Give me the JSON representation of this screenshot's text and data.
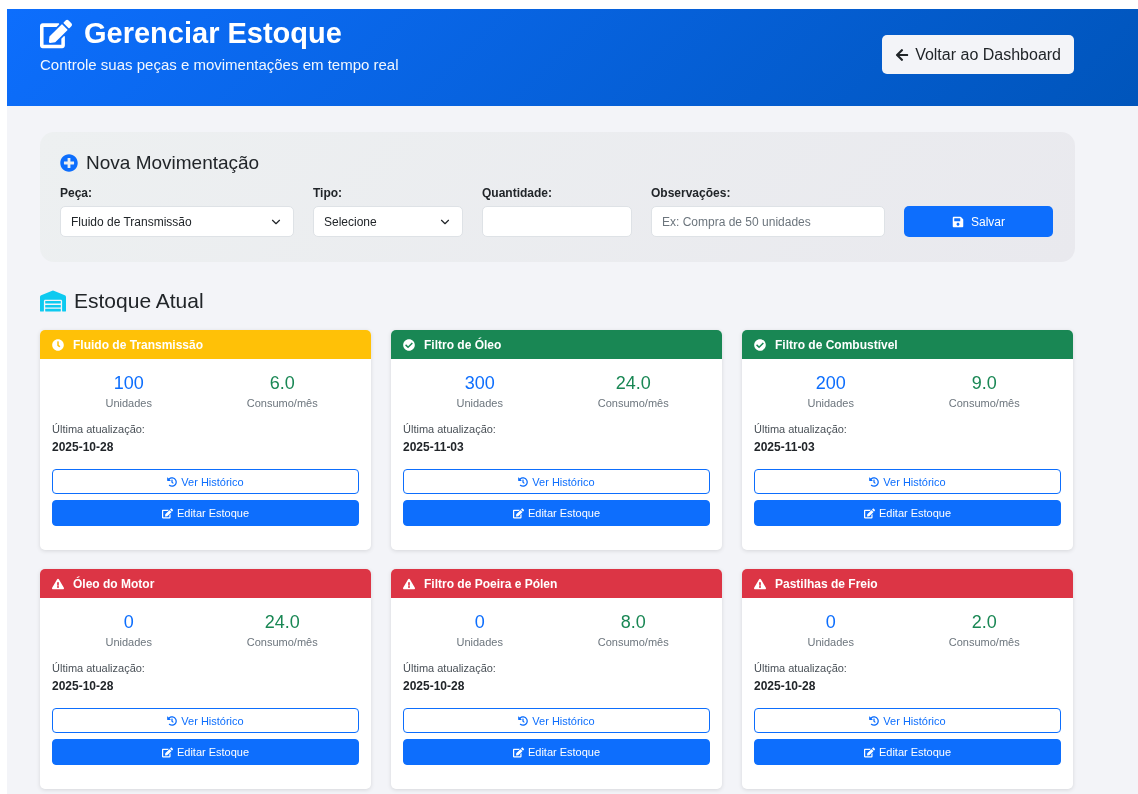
{
  "header": {
    "title": "Gerenciar Estoque",
    "subtitle": "Controle suas peças e movimentações em tempo real",
    "back_button": "Voltar ao Dashboard"
  },
  "form": {
    "title": "Nova Movimentação",
    "fields": [
      {
        "kind": "select",
        "label": "Peça:",
        "value": "Fluido de Transmissão"
      },
      {
        "kind": "select",
        "label": "Tipo:",
        "value": "Selecione"
      },
      {
        "kind": "input",
        "label": "Quantidade:"
      },
      {
        "kind": "input",
        "label": "Observações:",
        "placeholder": "Ex: Compra de 50 unidades"
      }
    ],
    "save_button": "Salvar"
  },
  "stock": {
    "title": "Estoque Atual",
    "cards": [
      {
        "kind": "warning",
        "name": "Fluido de Transmissão",
        "units": "100",
        "units_label": "Unidades",
        "consumption": "6.0",
        "consumption_label": "Consumo/mês",
        "updated_label": "Última atualização:",
        "updated": "2025-10-28",
        "history_button": "Ver Histórico",
        "edit_button": "Editar Estoque"
      },
      {
        "kind": "ok",
        "name": "Filtro de Óleo",
        "units": "300",
        "units_label": "Unidades",
        "consumption": "24.0",
        "consumption_label": "Consumo/mês",
        "updated_label": "Última atualização:",
        "updated": "2025-11-03",
        "history_button": "Ver Histórico",
        "edit_button": "Editar Estoque"
      },
      {
        "kind": "ok",
        "name": "Filtro de Combustível",
        "units": "200",
        "units_label": "Unidades",
        "consumption": "9.0",
        "consumption_label": "Consumo/mês",
        "updated_label": "Última atualização:",
        "updated": "2025-11-03",
        "history_button": "Ver Histórico",
        "edit_button": "Editar Estoque"
      },
      {
        "kind": "danger",
        "name": "Óleo do Motor",
        "units": "0",
        "units_label": "Unidades",
        "consumption": "24.0",
        "consumption_label": "Consumo/mês",
        "updated_label": "Última atualização:",
        "updated": "2025-10-28",
        "history_button": "Ver Histórico",
        "edit_button": "Editar Estoque"
      },
      {
        "kind": "danger",
        "name": "Filtro de Poeira e Pólen",
        "units": "0",
        "units_label": "Unidades",
        "consumption": "8.0",
        "consumption_label": "Consumo/mês",
        "updated_label": "Última atualização:",
        "updated": "2025-10-28",
        "history_button": "Ver Histórico",
        "edit_button": "Editar Estoque"
      },
      {
        "kind": "danger",
        "name": "Pastilhas de Freio",
        "units": "0",
        "units_label": "Unidades",
        "consumption": "2.0",
        "consumption_label": "Consumo/mês",
        "updated_label": "Última atualização:",
        "updated": "2025-10-28",
        "history_button": "Ver Histórico",
        "edit_button": "Editar Estoque"
      }
    ]
  }
}
